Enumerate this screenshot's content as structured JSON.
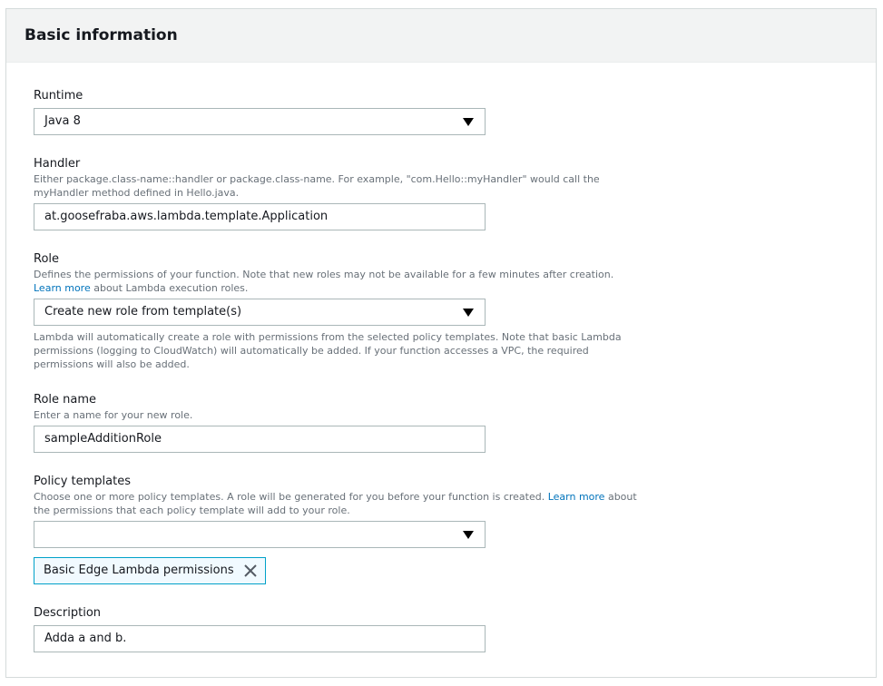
{
  "panel": {
    "title": "Basic information"
  },
  "runtime": {
    "label": "Runtime",
    "value": "Java 8"
  },
  "handler": {
    "label": "Handler",
    "description": "Either package.class-name::handler or package.class-name. For example, \"com.Hello::myHandler\" would call the myHandler method defined in Hello.java.",
    "value": "at.goosefraba.aws.lambda.template.Application"
  },
  "role": {
    "label": "Role",
    "description_before": "Defines the permissions of your function. Note that new roles may not be available for a few minutes after creation. ",
    "link": "Learn more",
    "description_after": " about Lambda execution roles.",
    "value": "Create new role from template(s)",
    "help": "Lambda will automatically create a role with permissions from the selected policy templates. Note that basic Lambda permissions (logging to CloudWatch) will automatically be added. If your function accesses a VPC, the required permissions will also be added."
  },
  "role_name": {
    "label": "Role name",
    "description": "Enter a name for your new role.",
    "value": "sampleAdditionRole"
  },
  "policy_templates": {
    "label": "Policy templates",
    "description_before": "Choose one or more policy templates. A role will be generated for you before your function is created. ",
    "link": "Learn more",
    "description_after": " about the permissions that each policy template will add to your role.",
    "value": "",
    "selected_token": "Basic Edge Lambda permissions"
  },
  "description": {
    "label": "Description",
    "value": "Adda a and b."
  },
  "icons": {
    "dropdown": "caret-down-icon",
    "remove": "close-icon"
  }
}
